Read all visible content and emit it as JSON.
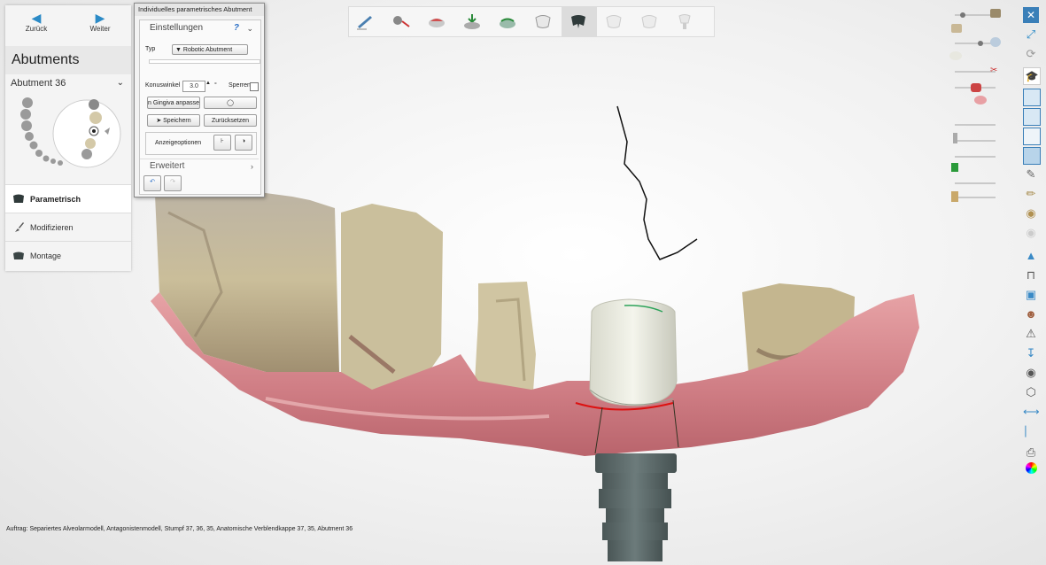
{
  "nav": {
    "back_label": "Zurück",
    "next_label": "Weiter"
  },
  "panel": {
    "title": "Abutments",
    "abutment_selector": "Abutment 36",
    "modes": [
      {
        "label": "Parametrisch",
        "active": true
      },
      {
        "label": "Modifizieren",
        "active": false
      },
      {
        "label": "Montage",
        "active": false
      }
    ]
  },
  "dialog": {
    "title": "Individuelles parametrisches Abutment",
    "section_settings": "Einstellungen",
    "help": "?",
    "typ_label": "Typ",
    "typ_value": "Robotic Abutment",
    "konus_label": "Konuswinkel",
    "konus_value": "3.0",
    "konus_unit": "°",
    "sperren_label": "Sperren",
    "gingiva_button": "n Gingiva anpassen",
    "save_button": "Speichern",
    "reset_button": "Zurücksetzen",
    "display_label": "Anzeigeoptionen",
    "section_advanced": "Erweitert"
  },
  "status": {
    "label": "Auftrag:",
    "value": "Separiertes Alveolarmodell, Antagonistenmodell, Stumpf 37, 36, 35, Anatomische Verblendkappe 37, 35, Abutment 36"
  },
  "colors": {
    "accent": "#2b8ac6",
    "gum": "#d98a90",
    "abutment": "#e7e8de",
    "implant": "#5a6a6a"
  }
}
